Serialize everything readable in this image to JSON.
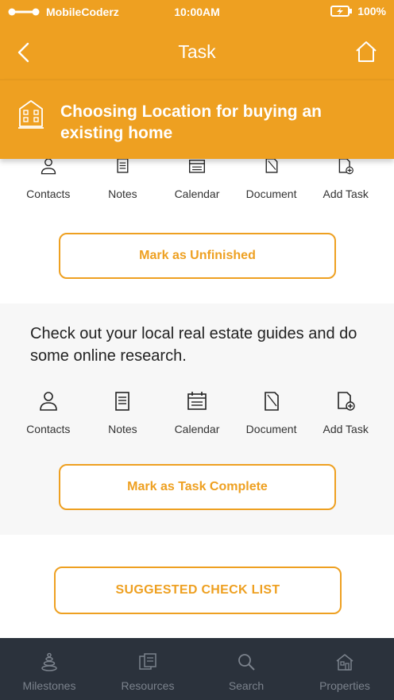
{
  "status_bar": {
    "carrier": "MobileCoderz",
    "time": "10:00AM",
    "battery": "100%"
  },
  "nav": {
    "title": "Task"
  },
  "banner": {
    "title": "Choosing Location for buying an existing home"
  },
  "actions": {
    "contacts": "Contacts",
    "notes": "Notes",
    "calendar": "Calendar",
    "document": "Document",
    "add_task": "Add Task"
  },
  "task1": {
    "button": "Mark as Unfinished"
  },
  "task2": {
    "text": "Check out your local real estate guides and do some online research.",
    "button": "Mark as Task Complete"
  },
  "checklist": {
    "button": "SUGGESTED CHECK LIST"
  },
  "tabs": [
    {
      "label": "Milestones",
      "icon": "milestones-icon"
    },
    {
      "label": "Resources",
      "icon": "resources-icon"
    },
    {
      "label": "Search",
      "icon": "search-icon"
    },
    {
      "label": "Properties",
      "icon": "properties-icon"
    }
  ],
  "colors": {
    "accent": "#eea021",
    "tab_bar": "#2b323c",
    "tab_label": "#7b828c"
  }
}
